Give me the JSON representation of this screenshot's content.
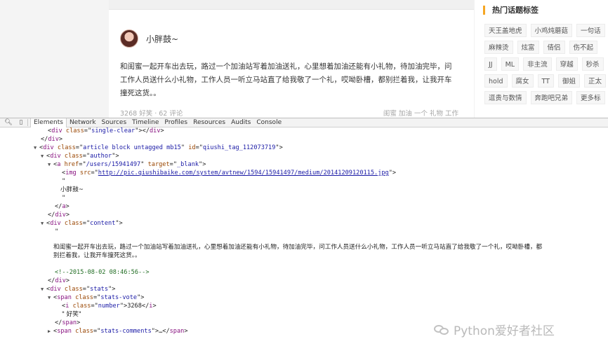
{
  "post": {
    "author_name": "小胖鼓~",
    "content": "和闺蜜一起开车出去玩，路过一个加油站写着加油送礼，心里想着加油还能有小礼物，待加油完毕，问工作人员送什么小礼物，工作人员一听立马站直了给我敬了一个礼，哎呦卧槽，都别拦着我，让我开车撞死这货。。",
    "stats": "3268 好笑 · 62 评论",
    "tags": "闺蜜 加油 一个 礼物 工作"
  },
  "sidebar": {
    "title": "热门话题标签",
    "rows": [
      [
        "天王盖地虎",
        "小鸡炖蘑菇",
        "一句话"
      ],
      [
        "麻辣烫",
        "炫富",
        "倩侣",
        "伤不起"
      ],
      [
        "JJ",
        "ML",
        "非主流",
        "穿越",
        "秒杀"
      ],
      [
        "hold",
        "腐女",
        "TT",
        "御姐",
        "正太"
      ],
      [
        "逗贵与数情",
        "奔跑吧兄弟",
        "更多标"
      ]
    ]
  },
  "devtools": {
    "tabs": [
      "Elements",
      "Network",
      "Sources",
      "Timeline",
      "Profiles",
      "Resources",
      "Audits",
      "Console"
    ],
    "active_tab": "Elements",
    "dom": {
      "l0_tag": "div",
      "l0_attr": "class",
      "l0_val": "single-clear",
      "l2_tag": "div",
      "l2_a1": "class",
      "l2_v1": "article block untagged mb15",
      "l2_a2": "id",
      "l2_v2": "qiushi_tag_112073719",
      "l3_tag": "div",
      "l3_attr": "class",
      "l3_val": "author",
      "l4_tag": "a",
      "l4_a1": "href",
      "l4_v1": "/users/15941497",
      "l4_a2": "target",
      "l4_v2": "_blank",
      "l5_tag": "img",
      "l5_attr": "src",
      "l5_val": "http://pic.qiushibaike.com/system/avtnew/1594/15941497/medium/20141209120115.jpg",
      "author_text": "小胖鼓~",
      "content_class": "content",
      "content_text_1": "和闺蜜一起开车出去玩，路过一个加油站写着加油送礼，心里想着加油还能有小礼物，待加油完毕，问工作人员送什么小礼物，工作人员一听立马站直了给我敬了一个礼，哎呦卧槽，都",
      "content_text_2": "别拦着我，让我开车撞死这货。。",
      "comment": "<!--2015-08-02 08:46:56-->",
      "stats_class": "stats",
      "vote_class": "stats-vote",
      "number_class": "number",
      "number_value": "3268",
      "vote_text": "\" 好笑\"",
      "comments_class": "stats-comments"
    }
  },
  "watermark": "Python爱好者社区"
}
